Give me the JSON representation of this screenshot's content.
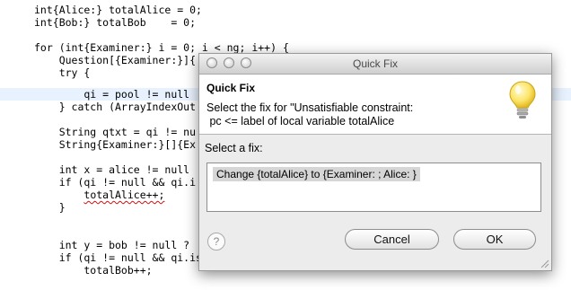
{
  "editor": {
    "lines": [
      "int{Alice:} totalAlice = 0;",
      "int{Bob:} totalBob    = 0;",
      "",
      "for (int{Examiner:} i = 0; i < ng; i++) {",
      "    Question[{Examiner:}]{",
      "    try {",
      "        qi = pool != null",
      "    } catch (ArrayIndexOut",
      "",
      "    String qtxt = qi != nu",
      "    String{Examiner:}[]{Ex",
      "",
      "    int x = alice != null",
      "    if (qi != null && qi.i",
      "        ",
      "    }",
      "",
      "",
      "    int y = bob != null ?",
      "    if (qi != null && qi.isCorrect(y)) {",
      "        totalBob++;"
    ],
    "error_token": "totalAlice++;"
  },
  "dialog": {
    "title": "Quick Fix",
    "header_title": "Quick Fix",
    "header_description": "Select the fix for \"Unsatisfiable constraint:\n pc <= label of local variable totalAlice",
    "select_label": "Select a fix:",
    "fixes": [
      "Change {totalAlice} to {Examiner: ; Alice: }"
    ],
    "help_symbol": "?",
    "cancel_label": "Cancel",
    "ok_label": "OK"
  },
  "icons": {
    "close": "close-icon",
    "minimize": "minimize-icon",
    "zoom": "zoom-icon",
    "lightbulb": "lightbulb-icon",
    "help": "help-icon",
    "resize_grip": "resize-grip-icon"
  }
}
